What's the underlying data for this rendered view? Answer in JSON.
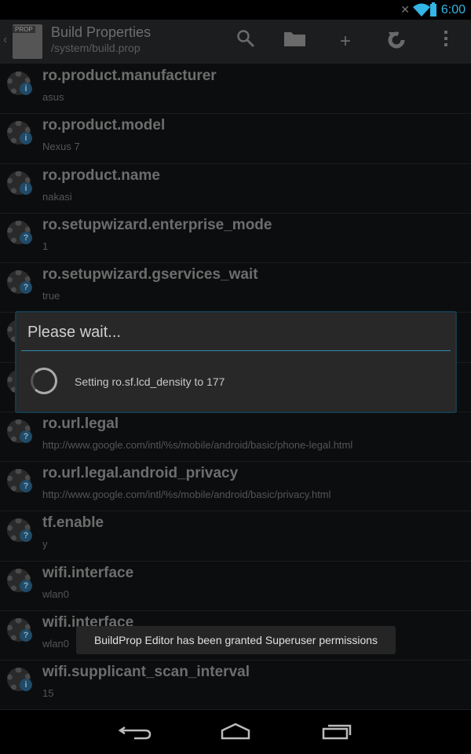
{
  "status": {
    "time": "6:00",
    "icons": [
      "mute-icon",
      "wifi-icon",
      "battery-icon"
    ],
    "accent": "#33b5e5"
  },
  "actionbar": {
    "title": "Build Properties",
    "subtitle": "/system/build.prop",
    "logo_text": "PROP",
    "actions": [
      "search-icon",
      "folder-icon",
      "add-icon",
      "refresh-icon",
      "overflow-icon"
    ]
  },
  "properties": [
    {
      "name": "ro.product.manufacturer",
      "value": "asus",
      "icon": "info"
    },
    {
      "name": "ro.product.model",
      "value": "Nexus 7",
      "icon": "info"
    },
    {
      "name": "ro.product.name",
      "value": "nakasi",
      "icon": "info"
    },
    {
      "name": "ro.setupwizard.enterprise_mode",
      "value": "1",
      "icon": "question"
    },
    {
      "name": "ro.setupwizard.gservices_wait",
      "value": "true",
      "icon": "question"
    },
    {
      "name": "",
      "value": "",
      "icon": "question"
    },
    {
      "name": "",
      "value": "",
      "icon": "question"
    },
    {
      "name": "ro.url.legal",
      "value": "http://www.google.com/intl/%s/mobile/android/basic/phone-legal.html",
      "icon": "question"
    },
    {
      "name": "ro.url.legal.android_privacy",
      "value": "http://www.google.com/intl/%s/mobile/android/basic/privacy.html",
      "icon": "question"
    },
    {
      "name": "tf.enable",
      "value": "y",
      "icon": "question"
    },
    {
      "name": "wifi.interface",
      "value": "wlan0",
      "icon": "question"
    },
    {
      "name": "wifi.interface",
      "value": "wlan0",
      "icon": "question"
    },
    {
      "name": "wifi.supplicant_scan_interval",
      "value": "15",
      "icon": "info"
    }
  ],
  "dialog": {
    "title": "Please wait...",
    "message": "Setting ro.sf.lcd_density to 177"
  },
  "toast": "BuildProp Editor has been granted Superuser permissions",
  "navbar": [
    "back-icon",
    "home-icon",
    "recents-icon"
  ]
}
